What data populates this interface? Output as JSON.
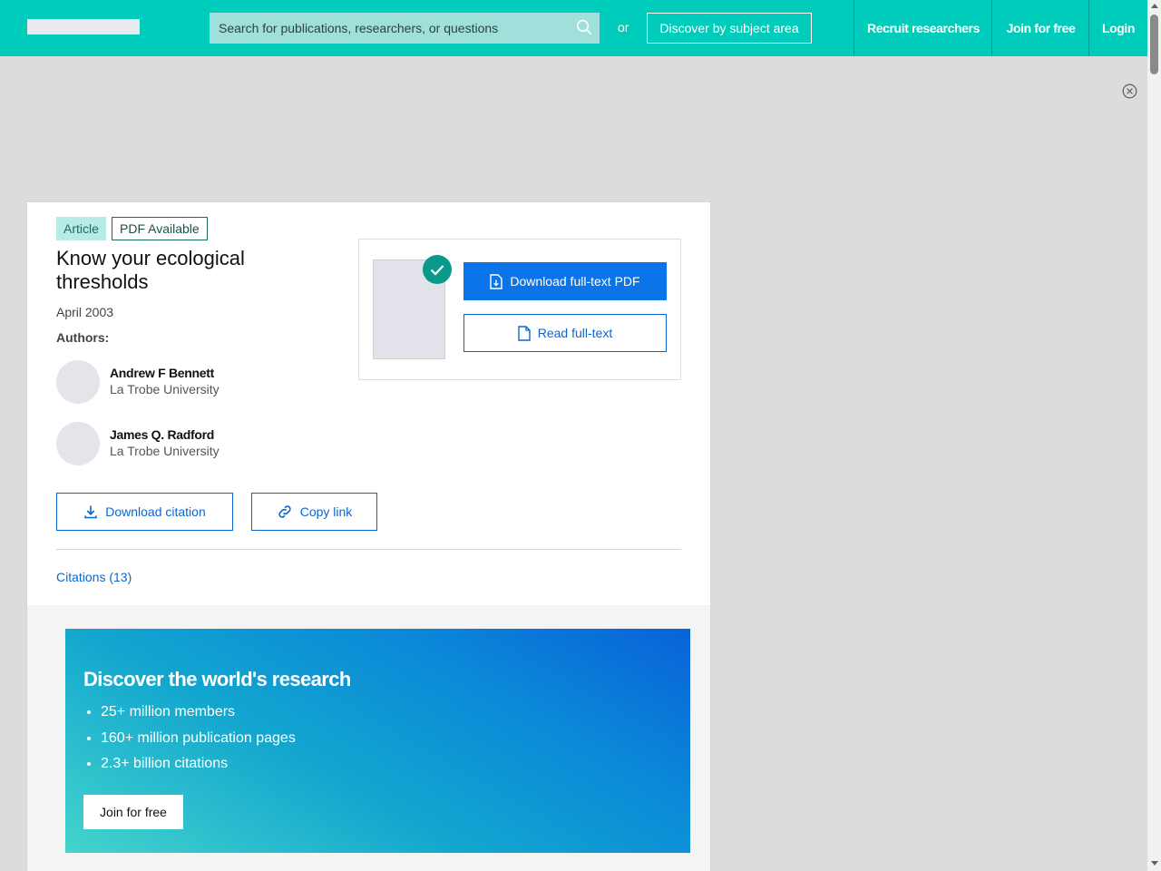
{
  "header": {
    "search_placeholder": "Search for publications, researchers, or questions",
    "or_text": "or",
    "subject_button": "Discover by subject area",
    "nav": [
      "Recruit researchers",
      "Join for free",
      "Login"
    ]
  },
  "article": {
    "type_badge": "Article",
    "pdf_badge": "PDF Available",
    "title": "Know your ecological thresholds",
    "date": "April 2003",
    "authors_label": "Authors:",
    "authors": [
      {
        "name": "Andrew F Bennett",
        "institution": "La Trobe University"
      },
      {
        "name": "James Q. Radford",
        "institution": "La Trobe University"
      }
    ],
    "download_citation": "Download citation",
    "copy_link": "Copy link",
    "citations": "Citations (13)",
    "download_pdf": "Download full-text PDF",
    "read_fulltext": "Read full-text"
  },
  "promo": {
    "title": "Discover the world's research",
    "points": [
      "25+ million members",
      "160+ million publication pages",
      "2.3+ billion citations"
    ],
    "join_button": "Join for free"
  },
  "colors": {
    "brand": "#00ccbb",
    "link": "#0b67d0",
    "primary_button": "#0a74e8"
  },
  "icons": {
    "search": "search-icon",
    "close": "close-circle-icon",
    "download": "download-icon",
    "link": "link-icon",
    "pdf_file": "pdf-file-icon",
    "document": "document-icon",
    "check": "check-icon"
  }
}
